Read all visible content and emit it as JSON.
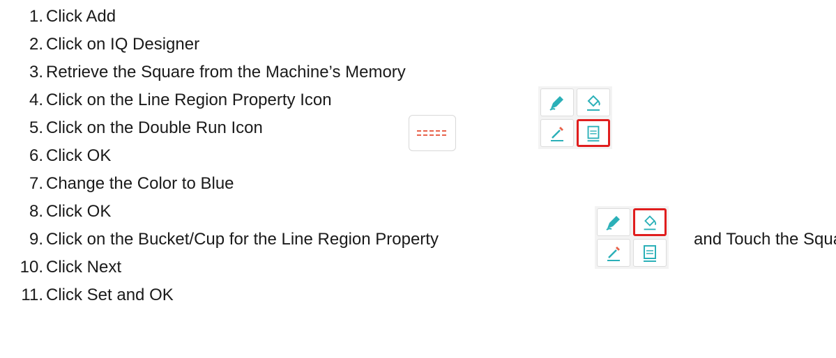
{
  "steps": [
    {
      "num": "1.",
      "text": "Click Add"
    },
    {
      "num": "2.",
      "text": "Click on IQ Designer"
    },
    {
      "num": "3.",
      "text": "Retrieve the Square from the Machine’s Memory"
    },
    {
      "num": "4.",
      "text": "Click on the Line Region Property Icon"
    },
    {
      "num": "5.",
      "text": "Click on the Double Run Icon"
    },
    {
      "num": "6.",
      "text": "Click OK"
    },
    {
      "num": "7.",
      "text": "Change the Color to Blue"
    },
    {
      "num": "8.",
      "text": "Click OK"
    },
    {
      "num": "9.",
      "text": "Click on the Bucket/Cup for the Line Region Property",
      "after": "and Touch the Square"
    },
    {
      "num": "10.",
      "text": "Click Next"
    },
    {
      "num": "11.",
      "text": "Click Set and OK"
    }
  ],
  "icons": {
    "palette_a": [
      "pen-icon",
      "bucket-icon",
      "eyedropper-icon",
      "line-region-icon"
    ],
    "palette_b": [
      "pen-icon",
      "bucket-icon",
      "eyedropper-icon",
      "line-region-icon"
    ],
    "double_run": "double-run-line-icon",
    "highlight_color": "#e01e1e",
    "icon_color": "#2bb0b8",
    "dash_color": "#e8614a"
  }
}
